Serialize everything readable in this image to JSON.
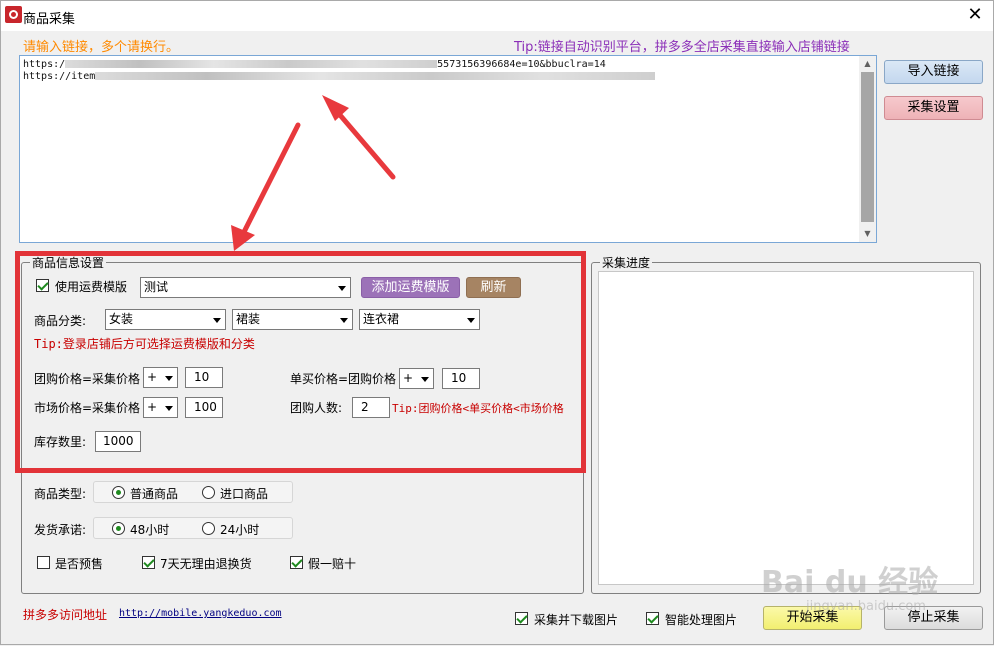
{
  "window": {
    "title": "商品采集",
    "close_glyph": "✕"
  },
  "hints": {
    "input_links": "请输入链接，多个请换行。",
    "tip_platform": "Tip:链接自动识别平台，拼多多全店采集直接输入店铺链接"
  },
  "links": {
    "line1_prefix": "https:/",
    "line1_suffix": "5573156396684e=10&bbuclra=14",
    "line2_prefix": "https://item"
  },
  "buttons": {
    "import_links": "导入链接",
    "collect_settings": "采集设置",
    "add_shipping_template": "添加运费模版",
    "refresh": "刷新",
    "start_collect": "开始采集",
    "stop_collect": "停止采集"
  },
  "product_info": {
    "group_title": "商品信息设置",
    "use_shipping_template": "使用运费模版",
    "shipping_template_value": "测试",
    "category_label": "商品分类:",
    "category1": "女装",
    "category2": "裙装",
    "category3": "连衣裙",
    "tip_login": "Tip:登录店铺后方可选择运费模版和分类",
    "group_price_label": "团购价格=采集价格",
    "group_price_op": "+",
    "group_price_value": "10",
    "single_price_label": "单买价格=团购价格",
    "single_price_op": "+",
    "single_price_value": "10",
    "market_price_label": "市场价格=采集价格",
    "market_price_op": "+",
    "market_price_value": "100",
    "group_size_label": "团购人数:",
    "group_size_value": "2",
    "tip_price_order": "Tip:团购价格<单买价格<市场价格",
    "stock_label": "库存数里:",
    "stock_value": "1000"
  },
  "product_type": {
    "label": "商品类型:",
    "option1": "普通商品",
    "option2": "进口商品",
    "selected": "普通商品"
  },
  "shipping_promise": {
    "label": "发货承诺:",
    "option1": "48小时",
    "option2": "24小时",
    "selected": "48小时"
  },
  "options": {
    "presale": "是否预售",
    "seven_day_return": "7天无理由退换货",
    "fake_compensation": "假一赔十"
  },
  "progress": {
    "group_title": "采集进度"
  },
  "footer": {
    "visit_label": "拼多多访问地址",
    "visit_url": "http://mobile.yangkeduo.com",
    "download_images": "采集并下载图片",
    "smart_images": "智能处理图片"
  },
  "watermark": {
    "main": "Bai du 经验",
    "sub": "jingyan.baidu.com"
  },
  "colors": {
    "red_highlight": "#e23338",
    "orange_hint": "#ff8a00",
    "purple_tip": "#8b2fb8",
    "red_tip": "#c80000"
  }
}
